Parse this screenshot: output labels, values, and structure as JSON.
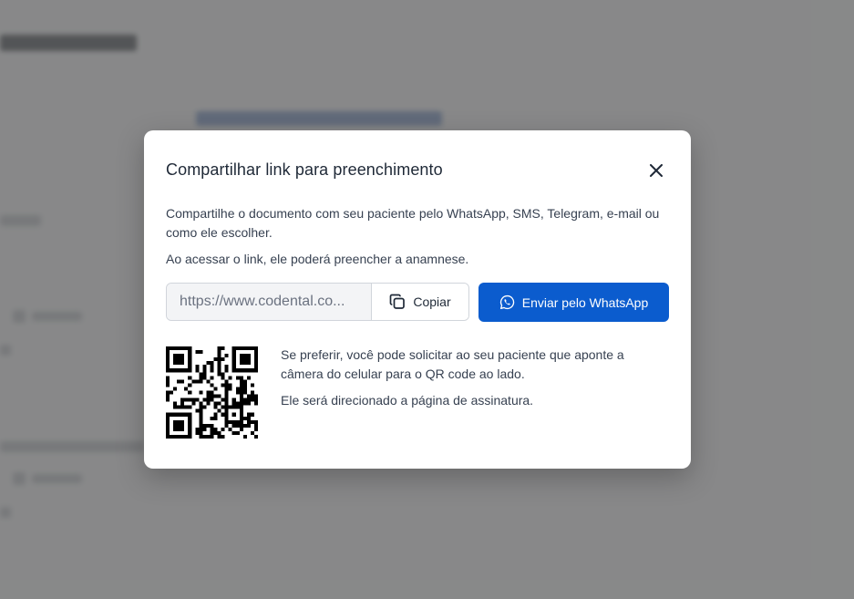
{
  "modal": {
    "title": "Compartilhar link para preenchimento",
    "close_icon": "close-icon",
    "description_1": "Compartilhe o documento com seu paciente pelo WhatsApp, SMS, Telegram, e-mail ou como ele escolher.",
    "description_2": "Ao acessar o link, ele poderá preencher a anamnese.",
    "link": {
      "value": "https://www.codental.co...",
      "copy_label": "Copiar",
      "copy_icon": "copy-icon"
    },
    "whatsapp_button": {
      "label": "Enviar pelo WhatsApp",
      "icon": "whatsapp-icon",
      "color": "#0b5cce"
    },
    "qr": {
      "icon": "qr-code",
      "text_1": "Se preferir, você pode solicitar ao seu paciente que aponte a câmera do celular para o QR code ao lado.",
      "text_2": "Ele será direcionado a página de assinatura."
    }
  }
}
